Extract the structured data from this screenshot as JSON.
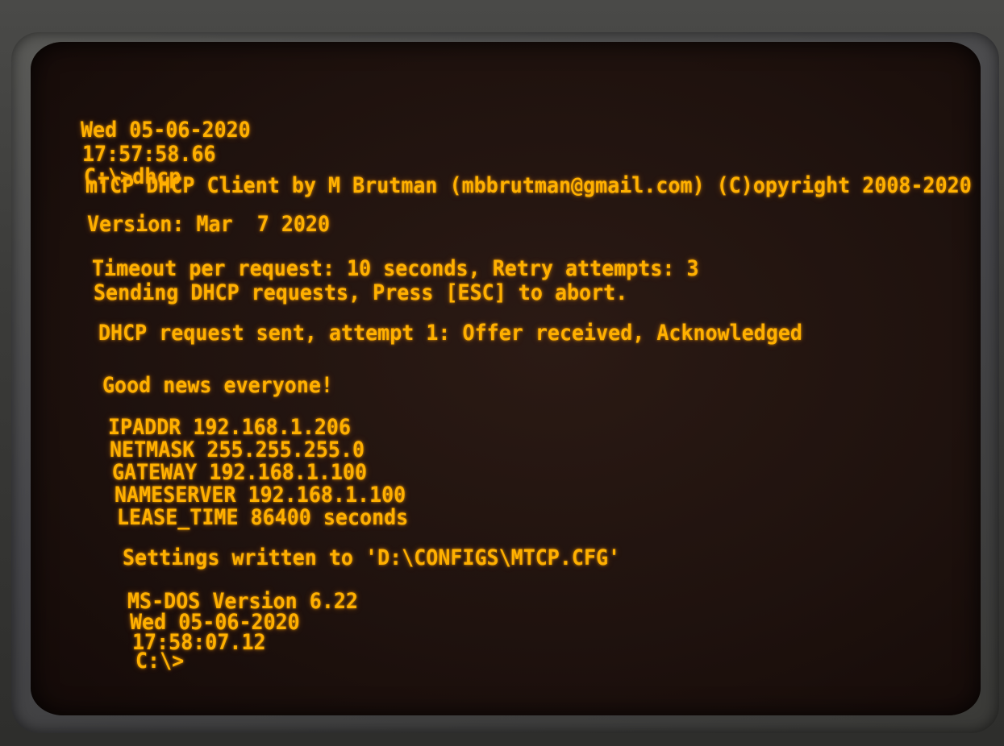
{
  "terminal": {
    "lines": [
      "Wed 05-06-2020",
      "17:57:58.66",
      "C:\\>dhcp",
      "mTCP DHCP Client by M Brutman (mbbrutman@gmail.com) (C)opyright 2008-2020",
      "Version: Mar  7 2020",
      "",
      "Timeout per request: 10 seconds, Retry attempts: 3",
      "Sending DHCP requests, Press [ESC] to abort.",
      "",
      "DHCP request sent, attempt 1: Offer received, Acknowledged",
      "",
      "Good news everyone!",
      "",
      "IPADDR 192.168.1.206",
      "NETMASK 255.255.255.0",
      "GATEWAY 192.168.1.100",
      "NAMESERVER 192.168.1.100",
      "LEASE_TIME 86400 seconds",
      "",
      "Settings written to 'D:\\CONFIGS\\MTCP.CFG'",
      "",
      "MS-DOS Version 6.22",
      "Wed 05-06-2020",
      "17:58:07.12",
      "C:\\>"
    ]
  },
  "colors": {
    "phosphor": "#ffb000",
    "screen": "#1f120e",
    "bezel": "#4a4a48"
  }
}
